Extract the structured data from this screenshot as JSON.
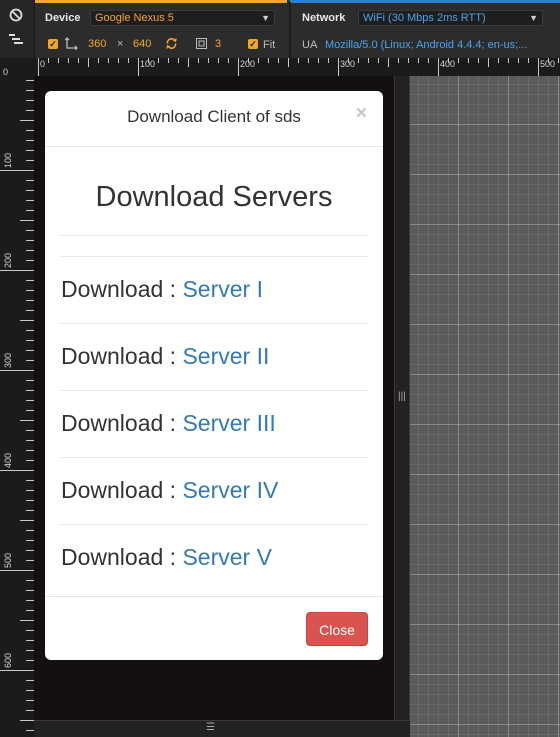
{
  "toolbar": {
    "device_label": "Device",
    "device_value": "Google Nexus 5",
    "width": "360",
    "height": "640",
    "times": "×",
    "device_pixel_ratio": "3",
    "fit_label": "Fit",
    "network_label": "Network",
    "network_value": "WiFi (30 Mbps 2ms RTT)",
    "ua_label": "UA",
    "ua_value": "Mozilla/5.0 (Linux; Android 4.4.4; en-us;..."
  },
  "ruler": {
    "h_labels": [
      "0",
      "100",
      "200",
      "300",
      "400",
      "500"
    ],
    "v_labels": [
      "100",
      "200",
      "300",
      "400",
      "500",
      "600"
    ],
    "corner": "0"
  },
  "modal": {
    "title": "Download Client of sds",
    "close_x": "×",
    "heading": "Download Servers",
    "rows": [
      {
        "prefix": "Download : ",
        "link": "Server I"
      },
      {
        "prefix": "Download : ",
        "link": "Server II"
      },
      {
        "prefix": "Download : ",
        "link": "Server III"
      },
      {
        "prefix": "Download : ",
        "link": "Server IV"
      },
      {
        "prefix": "Download : ",
        "link": "Server V"
      }
    ],
    "close_button": "Close"
  },
  "colors": {
    "device_accent": "#f5a623",
    "network_accent": "#2b7fd8",
    "link": "#337ab7",
    "close_button": "#d9534f"
  },
  "icons": {
    "no_emulation": "ban-icon",
    "menu": "menu-icon",
    "swap_dimensions": "swap-icon",
    "rotate": "rotate-icon",
    "pixel_ratio": "pixel-ratio-icon",
    "resize_handle": "resize-handle-icon"
  }
}
